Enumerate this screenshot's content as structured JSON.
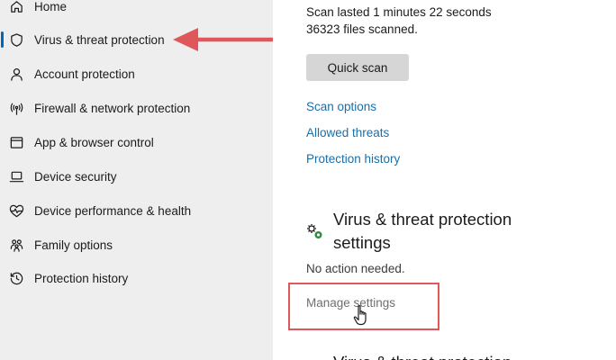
{
  "sidebar": {
    "items": [
      {
        "label": "Home",
        "icon": "home-icon"
      },
      {
        "label": "Virus & threat protection",
        "icon": "shield-icon",
        "active": true
      },
      {
        "label": "Account protection",
        "icon": "person-icon"
      },
      {
        "label": "Firewall & network protection",
        "icon": "wifi-antenna-icon"
      },
      {
        "label": "App & browser control",
        "icon": "app-window-icon"
      },
      {
        "label": "Device security",
        "icon": "laptop-icon"
      },
      {
        "label": "Device performance & health",
        "icon": "heart-pulse-icon"
      },
      {
        "label": "Family options",
        "icon": "family-icon"
      },
      {
        "label": "Protection history",
        "icon": "history-icon"
      }
    ]
  },
  "main": {
    "scan_duration": "Scan lasted 1 minutes 22 seconds",
    "files_scanned": "36323 files scanned.",
    "quick_scan_label": "Quick scan",
    "links": {
      "scan_options": "Scan options",
      "allowed_threats": "Allowed threats",
      "protection_history": "Protection history"
    },
    "settings_section": {
      "title_line1": "Virus & threat protection",
      "title_line2": "settings",
      "status": "No action needed.",
      "manage_link": "Manage settings"
    },
    "next_section_title_partial": "Virus & threat protection"
  },
  "annotations": {
    "arrow_color": "#e0575b",
    "box_color": "#e0575b"
  },
  "colors": {
    "sidebar_bg": "#eeeeee",
    "accent": "#0067c0",
    "link": "#1a6fa8",
    "button_bg": "#d6d6d6"
  }
}
